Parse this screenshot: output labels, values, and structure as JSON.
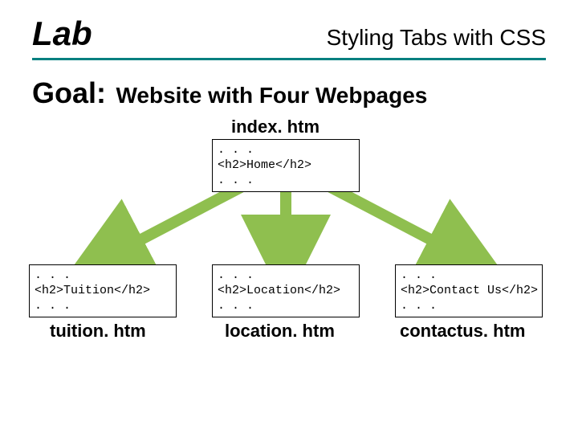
{
  "header": {
    "lab": "Lab",
    "title": "Styling Tabs with CSS"
  },
  "goal": {
    "label": "Goal:",
    "text": "Website with Four Webpages"
  },
  "files": {
    "index": {
      "name": "index. htm",
      "l1": ". . .",
      "l2": "  <h2>Home</h2>",
      "l3": ". . ."
    },
    "tuition": {
      "name": "tuition. htm",
      "l1": ". . .",
      "l2": "<h2>Tuition</h2>",
      "l3": ". . ."
    },
    "location": {
      "name": "location. htm",
      "l1": ". . .",
      "l2": "<h2>Location</h2>",
      "l3": ". . ."
    },
    "contact": {
      "name": "contactus. htm",
      "l1": ". . .",
      "l2": "<h2>Contact Us</h2>",
      "l3": ". . ."
    }
  }
}
